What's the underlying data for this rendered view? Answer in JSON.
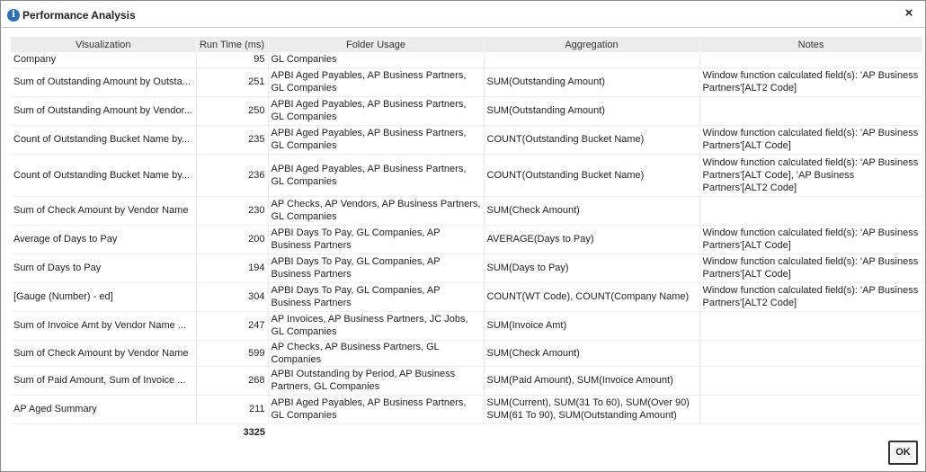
{
  "window": {
    "title": "Performance Analysis",
    "info_icon": "info-icon",
    "close_icon": "close-icon",
    "close_glyph": "×"
  },
  "columns": [
    "Visualization",
    "Run Time (ms)",
    "Folder Usage",
    "Aggregation",
    "Notes"
  ],
  "rows": [
    {
      "viz": "Company",
      "time": "95",
      "folders": "GL Companies",
      "agg": "",
      "notes": ""
    },
    {
      "viz": "Sum of Outstanding Amount by Outsta...",
      "time": "251",
      "folders": "APBI Aged Payables, AP Business Partners, GL Companies",
      "agg": "SUM(Outstanding Amount)",
      "notes": "Window function calculated field(s): 'AP Business Partners'[ALT2 Code]"
    },
    {
      "viz": "Sum of Outstanding Amount by Vendor...",
      "time": "250",
      "folders": "APBI Aged Payables, AP Business Partners, GL Companies",
      "agg": "SUM(Outstanding Amount)",
      "notes": ""
    },
    {
      "viz": "Count of Outstanding Bucket Name by...",
      "time": "235",
      "folders": "APBI Aged Payables, AP Business Partners, GL Companies",
      "agg": "COUNT(Outstanding Bucket Name)",
      "notes": "Window function calculated field(s): 'AP Business Partners'[ALT Code]"
    },
    {
      "viz": "Count of Outstanding Bucket Name by...",
      "time": "236",
      "folders": "APBI Aged Payables, AP Business Partners, GL Companies",
      "agg": "COUNT(Outstanding Bucket Name)",
      "notes": "Window function calculated field(s): 'AP Business Partners'[ALT Code], 'AP Business Partners'[ALT2 Code]"
    },
    {
      "viz": "Sum of Check Amount by Vendor Name",
      "time": "230",
      "folders": "AP Checks, AP Vendors, AP Business Partners, GL Companies",
      "agg": "SUM(Check Amount)",
      "notes": ""
    },
    {
      "viz": "Average of Days to Pay",
      "time": "200",
      "folders": "APBI Days To Pay, GL Companies, AP Business Partners",
      "agg": "AVERAGE(Days to Pay)",
      "notes": "Window function calculated field(s): 'AP Business Partners'[ALT Code]"
    },
    {
      "viz": "Sum of Days to Pay",
      "time": "194",
      "folders": "APBI Days To Pay, GL Companies, AP Business Partners",
      "agg": "SUM(Days to Pay)",
      "notes": "Window function calculated field(s): 'AP Business Partners'[ALT Code]"
    },
    {
      "viz": "[Gauge (Number) - ed]",
      "time": "304",
      "folders": "APBI Days To Pay, GL Companies, AP Business Partners",
      "agg": "COUNT(WT Code), COUNT(Company Name)",
      "notes": "Window function calculated field(s): 'AP Business Partners'[ALT2 Code]"
    },
    {
      "viz": "Sum of Invoice Amt by Vendor Name ...",
      "time": "247",
      "folders": "AP Invoices, AP Business Partners, JC Jobs, GL Companies",
      "agg": "SUM(Invoice Amt)",
      "notes": ""
    },
    {
      "viz": "Sum of Check Amount by Vendor Name",
      "time": "599",
      "folders": "AP Checks, AP Business Partners, GL Companies",
      "agg": "SUM(Check Amount)",
      "notes": ""
    },
    {
      "viz": "Sum of Paid Amount, Sum of Invoice ...",
      "time": "268",
      "folders": "APBI Outstanding by Period, AP Business Partners, GL Companies",
      "agg": "SUM(Paid Amount), SUM(Invoice Amount)",
      "notes": ""
    },
    {
      "viz": "AP Aged Summary",
      "time": "211",
      "folders": "APBI Aged Payables, AP Business Partners, GL Companies",
      "agg": "SUM(Current), SUM(31 To 60), SUM(Over 90) SUM(61 To 90), SUM(Outstanding Amount)",
      "notes": ""
    }
  ],
  "total": "3325",
  "ok_label": "OK"
}
